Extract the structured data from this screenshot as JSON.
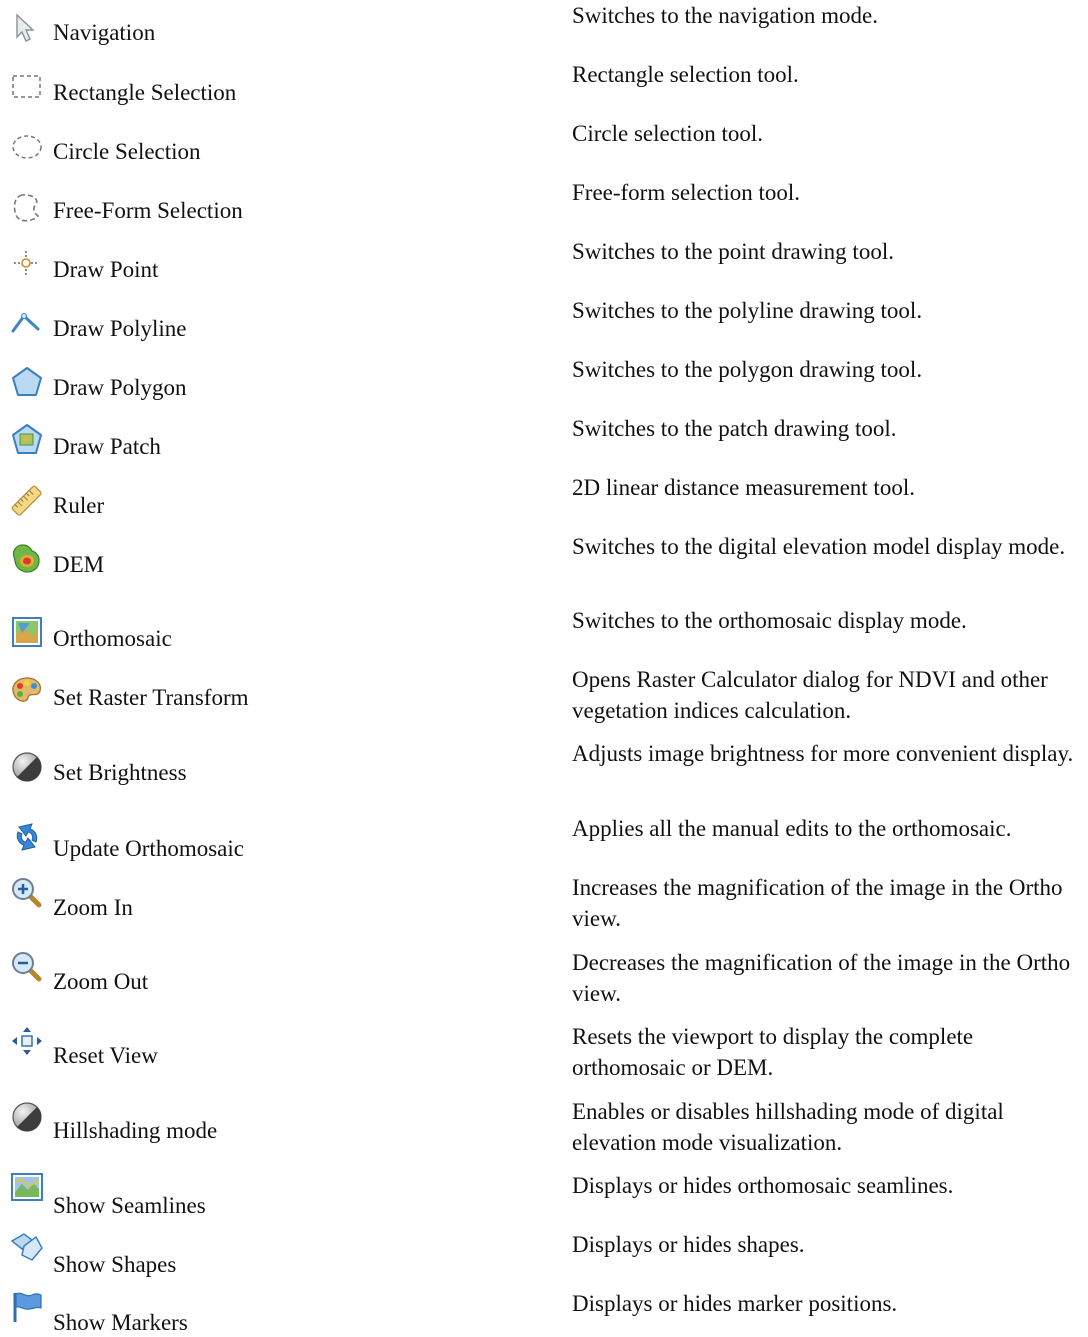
{
  "tools": [
    {
      "icon": "cursor-arrow-icon",
      "name": "Navigation",
      "desc": "Switches to the navigation mode."
    },
    {
      "icon": "rectangle-selection-icon",
      "name": "Rectangle Selection",
      "desc": "Rectangle selection tool."
    },
    {
      "icon": "circle-selection-icon",
      "name": "Circle Selection",
      "desc": "Circle selection tool."
    },
    {
      "icon": "free-form-selection-icon",
      "name": "Free-Form Selection",
      "desc": "Free-form selection tool."
    },
    {
      "icon": "draw-point-icon",
      "name": "Draw Point",
      "desc": "Switches to the point drawing tool."
    },
    {
      "icon": "draw-polyline-icon",
      "name": "Draw Polyline",
      "desc": "Switches to the polyline drawing tool."
    },
    {
      "icon": "draw-polygon-icon",
      "name": "Draw Polygon",
      "desc": "Switches to the polygon drawing tool."
    },
    {
      "icon": "draw-patch-icon",
      "name": "Draw Patch",
      "desc": "Switches to the patch drawing tool."
    },
    {
      "icon": "ruler-icon",
      "name": "Ruler",
      "desc": "2D linear distance measurement tool."
    },
    {
      "icon": "dem-icon",
      "name": "DEM",
      "desc": "Switches to the digital elevation model display mode."
    },
    {
      "icon": "orthomosaic-icon",
      "name": "Orthomosaic",
      "desc": "Switches to the orthomosaic display mode."
    },
    {
      "icon": "palette-icon",
      "name": "Set Raster Transform",
      "desc": "Opens Raster Calculator dialog for NDVI and other vegetation indices calculation."
    },
    {
      "icon": "brightness-icon",
      "name": "Set Brightness",
      "desc": "Adjusts image brightness for more convenient display."
    },
    {
      "icon": "update-icon",
      "name": "Update Orthomosaic",
      "desc": "Applies all the manual edits to the orthomosaic."
    },
    {
      "icon": "zoom-in-icon",
      "name": "Zoom In",
      "desc": "Increases the magnification of the image in the Ortho view."
    },
    {
      "icon": "zoom-out-icon",
      "name": "Zoom Out",
      "desc": "Decreases the magnification of the image in the Ortho view."
    },
    {
      "icon": "reset-view-icon",
      "name": "Reset View",
      "desc": "Resets the viewport to display the complete orthomosaic or DEM."
    },
    {
      "icon": "hillshading-icon",
      "name": "Hillshading mode",
      "desc": "Enables or disables hillshading mode of digital elevation mode visualization."
    },
    {
      "icon": "seamlines-icon",
      "name": "Show Seamlines",
      "desc": "Displays or hides orthomosaic seamlines."
    },
    {
      "icon": "shapes-icon",
      "name": "Show Shapes",
      "desc": "Displays or hides shapes."
    },
    {
      "icon": "markers-icon",
      "name": "Show Markers",
      "desc": "Displays or hides marker positions."
    }
  ]
}
